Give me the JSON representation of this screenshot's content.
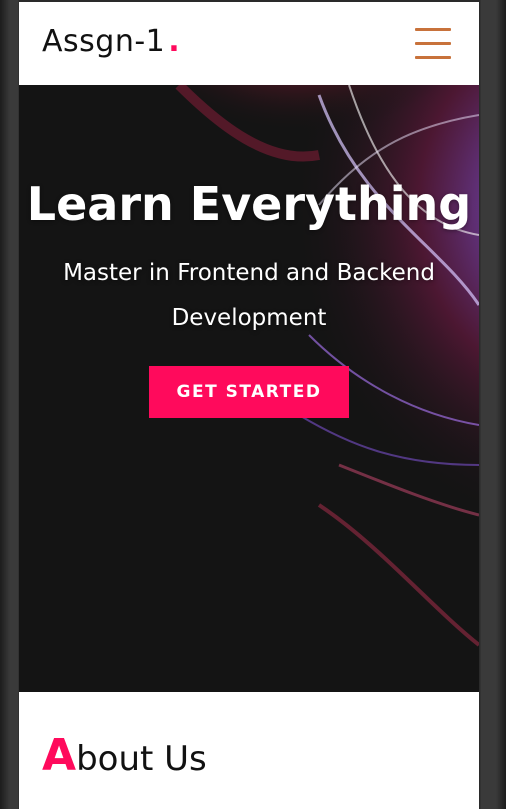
{
  "navbar": {
    "brand": "Assgn-1",
    "brand_dot": ".",
    "menu_icon": "hamburger-menu-icon"
  },
  "hero": {
    "title": "Learn Everything",
    "subtitle": "Master in Frontend and Backend Development",
    "button_label": "GET STARTED",
    "background_image": "plasma-ball-hand-image"
  },
  "about": {
    "heading_first_letter": "A",
    "heading_rest": "bout Us"
  },
  "colors": {
    "accent": "#ff0a5c",
    "menu_icon": "#c8723b",
    "hero_bg": "#141414"
  }
}
